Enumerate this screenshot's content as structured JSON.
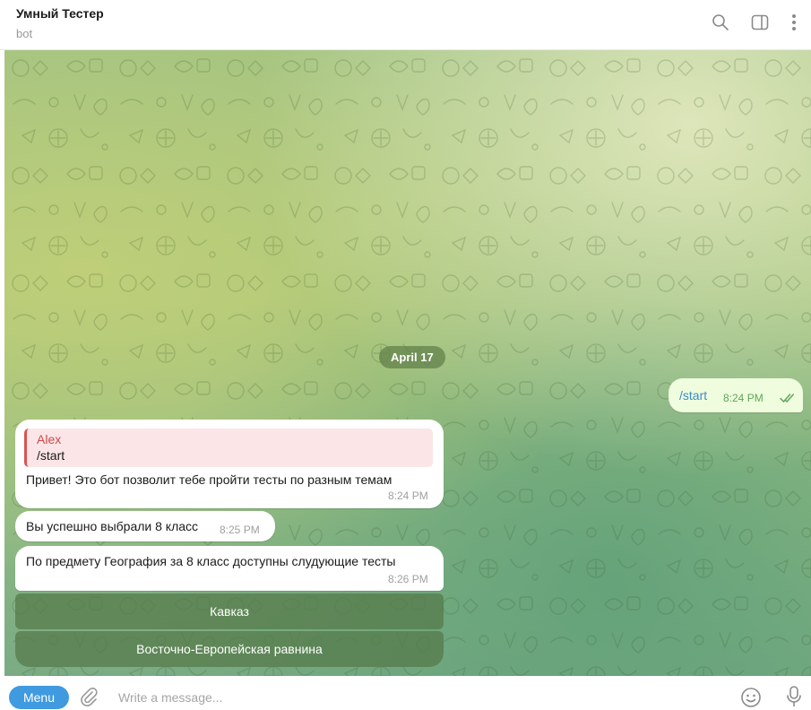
{
  "header": {
    "title": "Умный Тестер",
    "subtitle": "bot",
    "icons": [
      "search-icon",
      "sidebar-toggle-icon",
      "more-vertical-icon"
    ]
  },
  "chat": {
    "date_divider": "April 17",
    "outgoing": {
      "text": "/start",
      "time": "8:24 PM",
      "status": "read"
    },
    "messages": [
      {
        "reply_author": "Alex",
        "reply_text": "/start",
        "text": "Привет! Это бот позволит тебе пройти тесты по разным темам",
        "time": "8:24 PM"
      },
      {
        "text": "Вы успешно выбрали 8 класс",
        "time": "8:25 PM"
      },
      {
        "text": "По предмету География за 8 класс доступны слудующие тесты",
        "time": "8:26 PM"
      }
    ],
    "inline_buttons": [
      "Кавказ",
      "Восточно-Европейская равнина"
    ]
  },
  "composer": {
    "menu_label": "Menu",
    "placeholder": "Write a message...",
    "icons": [
      "attach-icon",
      "emoji-icon",
      "microphone-icon"
    ]
  },
  "colors": {
    "accent": "#3f9ae0",
    "outgoing_bubble": "#effdde",
    "reply_author": "#d14848",
    "keyboard_button": "#547848"
  }
}
